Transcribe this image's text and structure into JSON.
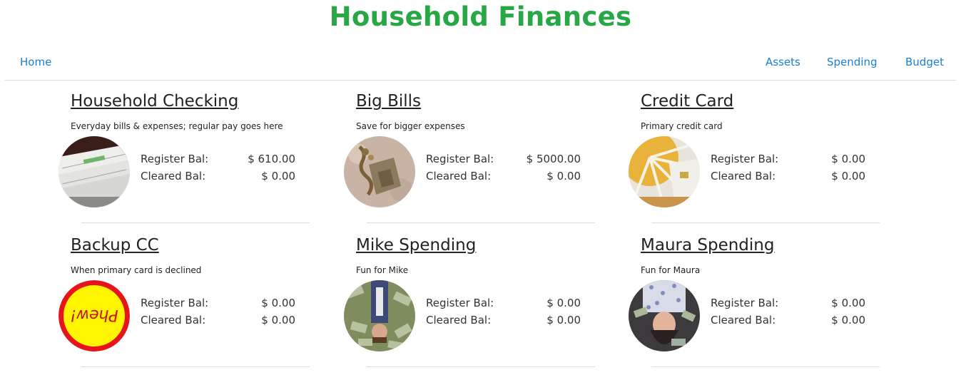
{
  "app": {
    "title": "Household Finances"
  },
  "nav": {
    "home": "Home",
    "assets": "Assets",
    "spending": "Spending",
    "budget": "Budget"
  },
  "labels": {
    "register": "Register Bal:",
    "cleared": "Cleared Bal:"
  },
  "accounts": [
    {
      "name": "Household Checking",
      "description": "Everyday bills & expenses; regular pay goes here",
      "register": "$ 610.00",
      "cleared": "$ 0.00"
    },
    {
      "name": "Big Bills",
      "description": "Save for bigger expenses",
      "register": "$ 5000.00",
      "cleared": "$ 0.00"
    },
    {
      "name": "Credit Card",
      "description": "Primary credit card",
      "register": "$ 0.00",
      "cleared": "$ 0.00"
    },
    {
      "name": "Backup CC",
      "description": "When primary card is declined",
      "register": "$ 0.00",
      "cleared": "$ 0.00",
      "badge_text": "Phew!"
    },
    {
      "name": "Mike Spending",
      "description": "Fun for Mike",
      "register": "$ 0.00",
      "cleared": "$ 0.00"
    },
    {
      "name": "Maura Spending",
      "description": "Fun for Maura",
      "register": "$ 0.00",
      "cleared": "$ 0.00"
    }
  ],
  "colors": {
    "title": "#28a745",
    "link": "#1a7fd4",
    "divider": "#dddddd",
    "badge_red": "#e8141c",
    "badge_yellow": "#fff500"
  }
}
